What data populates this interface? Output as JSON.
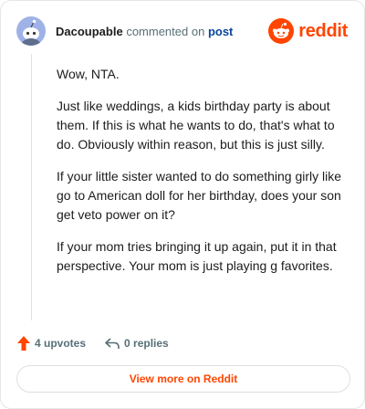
{
  "header": {
    "username": "Dacoupable",
    "action_text": "commented on",
    "post_link": "post",
    "brand_name": "reddit"
  },
  "comment": {
    "paragraphs": [
      "Wow, NTA.",
      "Just like weddings, a kids birthday party is about them. If this is what he wants to do, that's what to do. Obviously within reason, but this is just silly.",
      "If your little sister wanted to do something girly like go to American doll for her birthday, does your son get veto power on it?",
      "If your mom tries bringing it up again, put it in that perspective. Your mom is just playing g favorites."
    ]
  },
  "actions": {
    "upvotes_label": "4 upvotes",
    "replies_label": "0 replies"
  },
  "footer": {
    "view_more_label": "View more on Reddit"
  },
  "colors": {
    "brand": "#ff4500",
    "link": "#0a449b",
    "muted": "#576f76",
    "avatar": "#9fb2e8"
  },
  "icons": {
    "avatar": "snoo-avatar-icon",
    "brand": "reddit-logo-icon",
    "upvote": "upvote-arrow-icon",
    "reply": "reply-arrow-icon"
  }
}
